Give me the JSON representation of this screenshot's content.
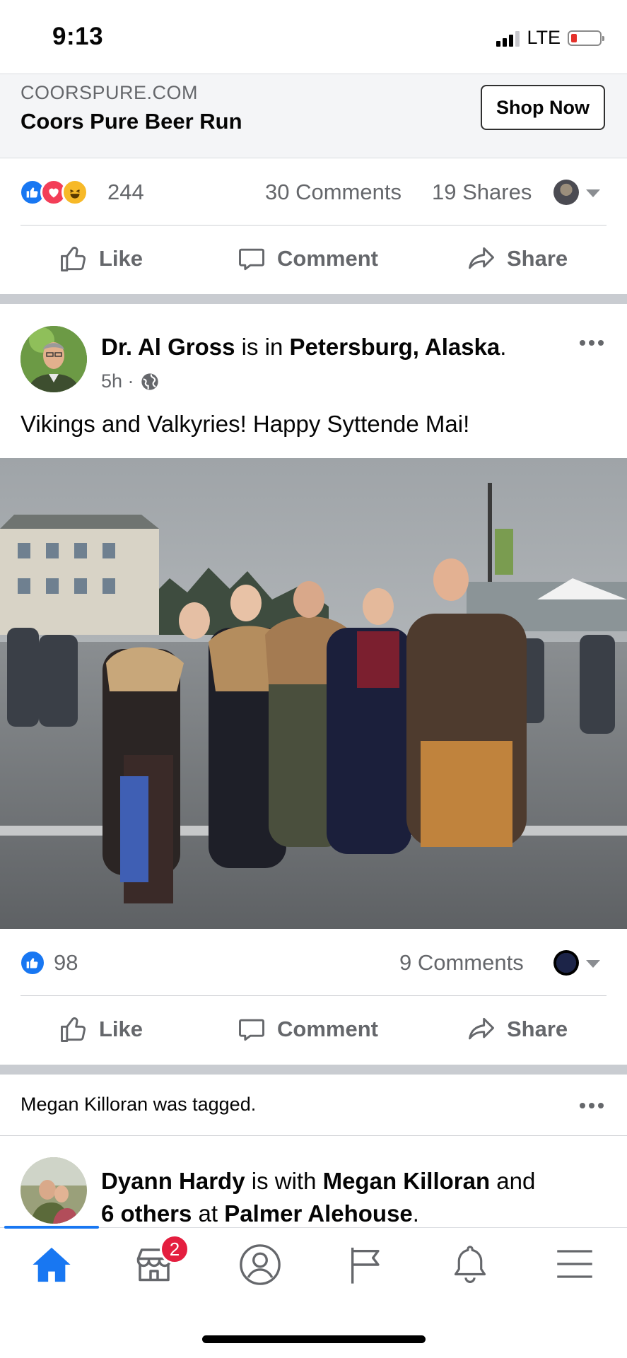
{
  "status_bar": {
    "time": "9:13",
    "network": "LTE"
  },
  "ad": {
    "domain": "COORSPURE.COM",
    "title": "Coors Pure Beer Run",
    "cta": "Shop Now"
  },
  "post1_stats": {
    "reaction_count": "244",
    "comments": "30 Comments",
    "shares": "19 Shares"
  },
  "actions": {
    "like": "Like",
    "comment": "Comment",
    "share": "Share"
  },
  "post2": {
    "author": "Dr. Al Gross",
    "connector": " is in ",
    "location": "Petersburg, Alaska",
    "period": ".",
    "time": "5h ·",
    "text": "Vikings and Valkyries! Happy Syttende Mai!",
    "reaction_count": "98",
    "comments": "9 Comments"
  },
  "post3": {
    "tag_name": "Megan Killoran",
    "tag_text": " was tagged.",
    "author": "Dyann Hardy",
    "with_text": " is with ",
    "with_name": "Megan Killoran",
    "and_text": " and",
    "others": "6 others",
    "at_text": " at ",
    "place": "Palmer Alehouse",
    "period": "."
  },
  "nav": {
    "marketplace_badge": "2"
  },
  "colors": {
    "accent": "#1877f2",
    "badge": "#e41e3f",
    "secondary_text": "#65676b"
  },
  "icons": [
    "like-icon",
    "comment-icon",
    "share-icon",
    "globe-icon",
    "home-icon",
    "marketplace-icon",
    "profile-icon",
    "pages-flag-icon",
    "notifications-bell-icon",
    "menu-icon"
  ]
}
